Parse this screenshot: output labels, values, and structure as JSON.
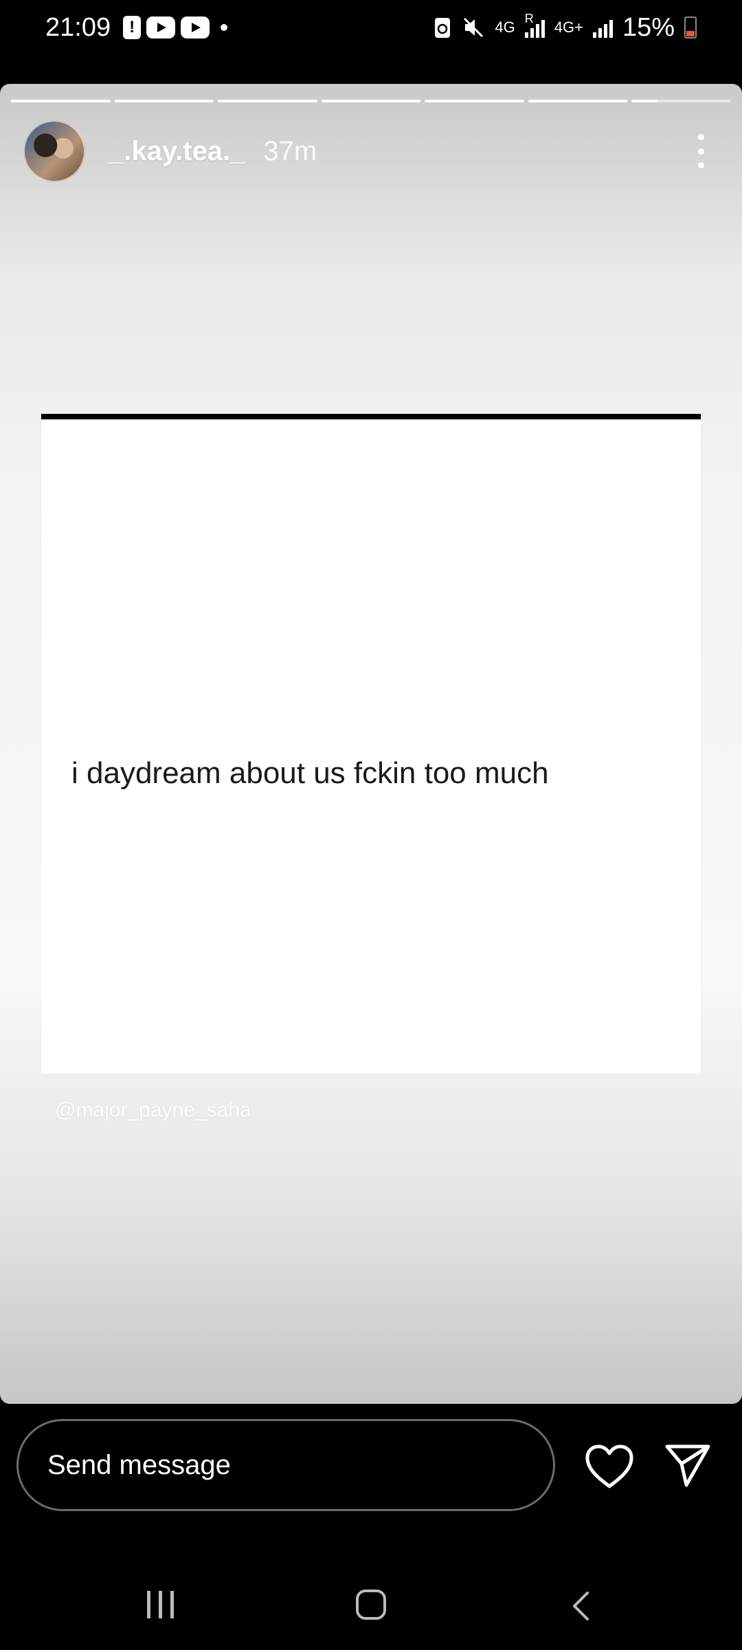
{
  "status_bar": {
    "time": "21:09",
    "network_1": "4G",
    "network_roaming": "R",
    "network_2": "4G+",
    "battery_percent": "15%",
    "icons": [
      "alert-icon",
      "youtube-icon",
      "youtube-icon",
      "dot-icon",
      "battery-saver-icon",
      "mute-icon",
      "signal-icon",
      "signal-icon",
      "battery-icon"
    ]
  },
  "story": {
    "segment_count": 7,
    "current_segment_progress": 0.25,
    "username": "_.kay.tea._",
    "timestamp": "37m",
    "post_text": "i daydream about us fckin too much",
    "mention": "@major_payne_saha"
  },
  "reply_bar": {
    "placeholder": "Send message",
    "icons": [
      "heart-icon",
      "send-icon"
    ]
  },
  "nav_bar": {
    "icons": [
      "recent-apps-icon",
      "home-icon",
      "back-icon"
    ]
  },
  "colors": {
    "background": "#000000",
    "battery_low": "#e2573a",
    "post_card": "#ffffff"
  }
}
